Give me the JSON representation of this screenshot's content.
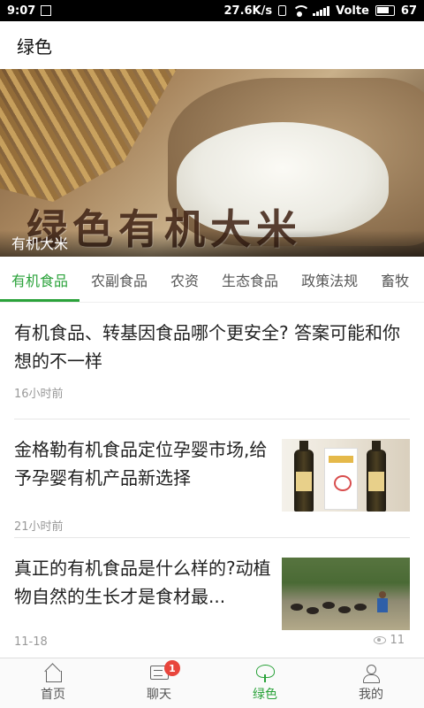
{
  "status_bar": {
    "time": "9:07",
    "net_speed": "27.6K/s",
    "carrier": "Volte",
    "battery": "67"
  },
  "header": {
    "title": "绿色"
  },
  "banner": {
    "image_text": "绿色有机大米",
    "caption": "有机大米"
  },
  "tabs": [
    {
      "label": "有机食品",
      "active": true
    },
    {
      "label": "农副食品",
      "active": false
    },
    {
      "label": "农资",
      "active": false
    },
    {
      "label": "生态食品",
      "active": false
    },
    {
      "label": "政策法规",
      "active": false
    },
    {
      "label": "畜牧",
      "active": false
    }
  ],
  "news": [
    {
      "title": "有机食品、转基因食品哪个更安全? 答案可能和你想的不一样",
      "time": "16小时前"
    },
    {
      "title": "金格勒有机食品定位孕婴市场,给予孕婴有机产品新选择",
      "time": "21小时前",
      "thumb_icon": "product-photo"
    },
    {
      "title": "真正的有机食品是什么样的?动植物自然的生长才是食材最...",
      "time": "11-18",
      "views": "11",
      "thumb_icon": "farm-photo"
    }
  ],
  "bottom_nav": {
    "items": [
      {
        "label": "首页",
        "icon": "home-icon"
      },
      {
        "label": "聊天",
        "icon": "chat-icon",
        "badge": "1"
      },
      {
        "label": "绿色",
        "icon": "tree-icon",
        "active": true
      },
      {
        "label": "我的",
        "icon": "user-icon"
      }
    ]
  },
  "colors": {
    "accent": "#2aa23a",
    "badge": "#e8453c"
  }
}
